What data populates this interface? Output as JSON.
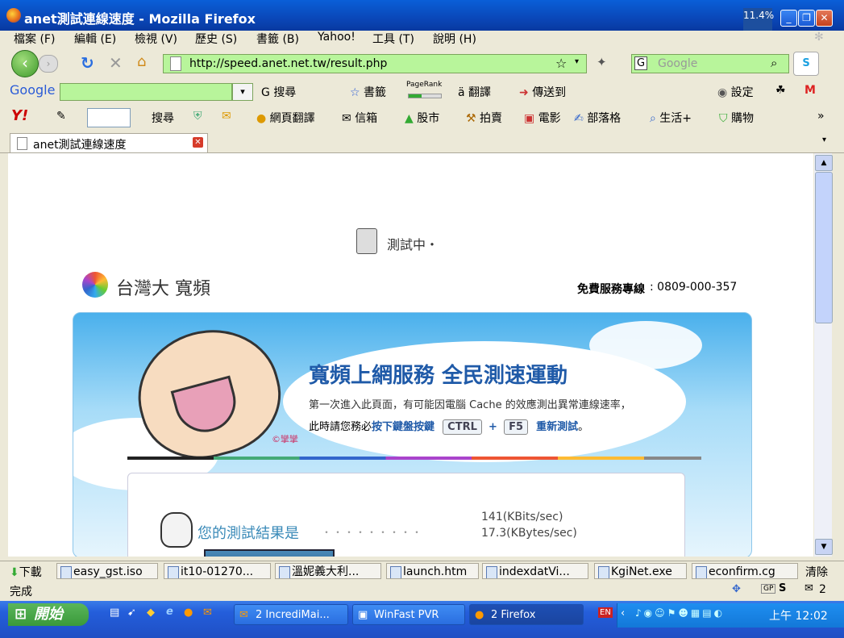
{
  "window": {
    "title": "anet測試連線速度 - Mozilla Firefox",
    "cpu": "11.4%"
  },
  "menu": [
    "檔案 (F)",
    "編輯 (E)",
    "檢視 (V)",
    "歷史 (S)",
    "書籤 (B)",
    "Yahoo!",
    "工具 (T)",
    "說明 (H)"
  ],
  "nav": {
    "url": "http://speed.anet.net.tw/result.php",
    "search_placeholder": "Google"
  },
  "google_toolbar": {
    "logo": "Google",
    "search": "搜尋",
    "bookmarks": "書籤",
    "pagerank": "PageRank",
    "translate": "翻譯",
    "sendto": "傳送到",
    "settings": "設定"
  },
  "yahoo_toolbar": {
    "search": "搜尋",
    "web_translate": "網頁翻譯",
    "mail": "信箱",
    "stock": "股市",
    "auction": "拍賣",
    "movie": "電影",
    "blog": "部落格",
    "life": "生活+",
    "shop": "購物"
  },
  "tab": {
    "label": "anet測試連線速度"
  },
  "page": {
    "testing": "測試中・",
    "brand": "台灣大 寬頻",
    "hotline_label": "免費服務專線",
    "hotline": ": 0809-000-357",
    "headline": "寬頻上網服務 全民測速運動",
    "note1": "第一次進入此頁面，有可能因電腦 Cache 的效應測出異常連線速率，",
    "note2a": "此時請您務必",
    "note2b": "按下鍵盤按鍵",
    "key1": "CTRL",
    "plus": "+",
    "key2": "F5",
    "note2c": "重新測試",
    "note2d": "。",
    "signature": "©攣攣",
    "result_label": "您的測試結果是",
    "dots": "・・・・・・・・・",
    "speed_kbits": "141(KBits/sec)",
    "speed_kbytes": "17.3(KBytes/sec)"
  },
  "downloads": {
    "label": "下載",
    "clear": "清除",
    "items": [
      "easy_gst.iso",
      "it10-01270...",
      "溫妮義大利...",
      "launch.htm",
      "indexdatVi...",
      "KgiNet.exe",
      "econfirm.cg"
    ]
  },
  "status": {
    "text": "完成",
    "badge": "GP",
    "count": "2"
  },
  "taskbar": {
    "start": "開始",
    "tasks": [
      "2 IncrediMai...",
      "WinFast PVR",
      "2 Firefox"
    ],
    "lang": "EN",
    "clock": "上午 12:02"
  }
}
